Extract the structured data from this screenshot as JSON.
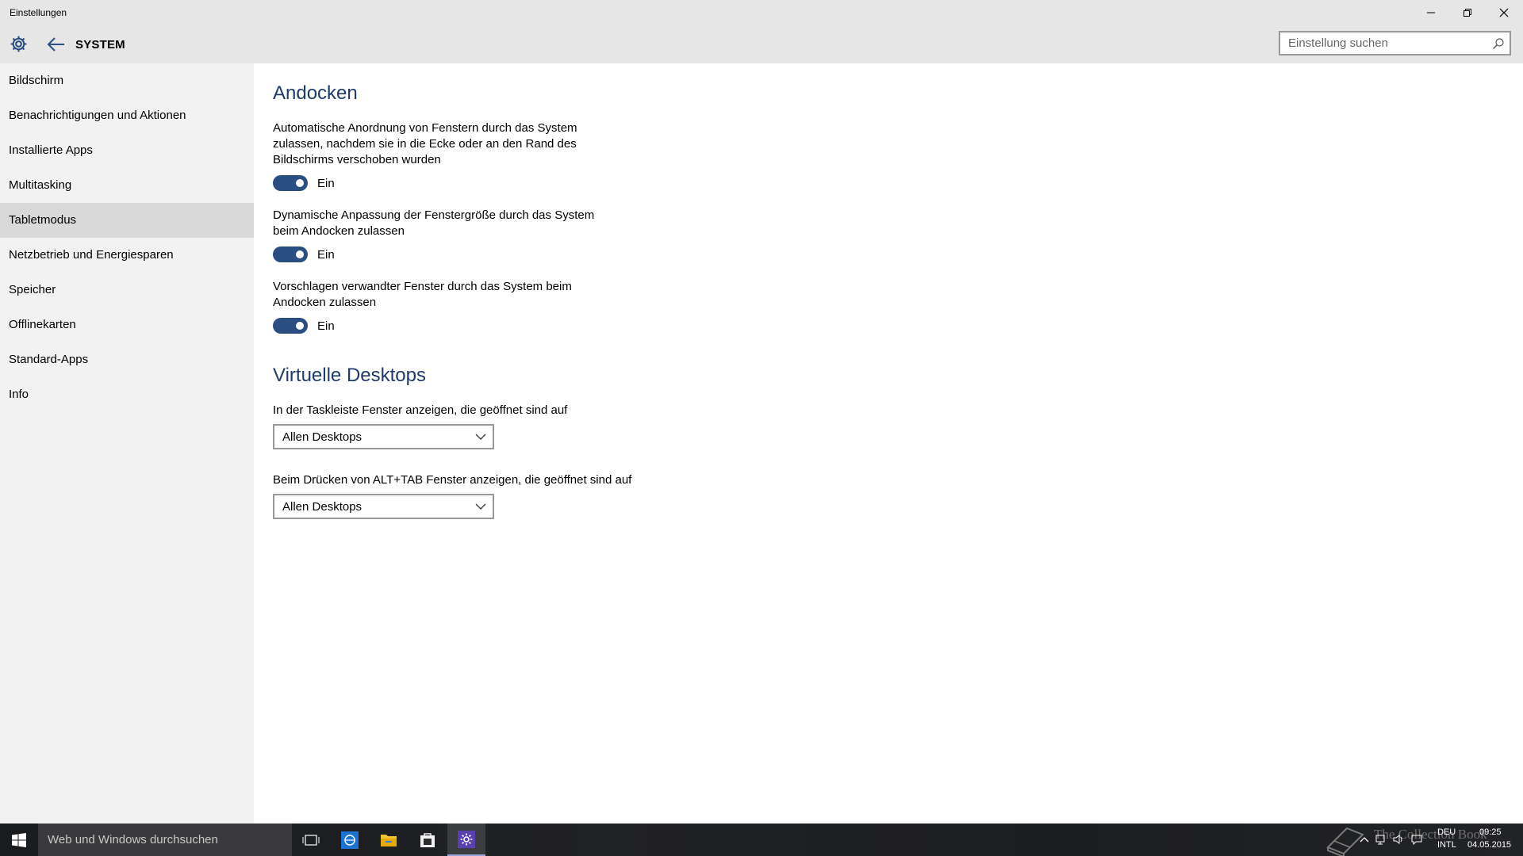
{
  "window": {
    "title": "Einstellungen"
  },
  "header": {
    "section_title": "SYSTEM",
    "search_placeholder": "Einstellung suchen"
  },
  "sidebar": {
    "items": [
      {
        "label": "Bildschirm"
      },
      {
        "label": "Benachrichtigungen und Aktionen"
      },
      {
        "label": "Installierte Apps"
      },
      {
        "label": "Multitasking"
      },
      {
        "label": "Tabletmodus"
      },
      {
        "label": "Netzbetrieb und Energiesparen"
      },
      {
        "label": "Speicher"
      },
      {
        "label": "Offlinekarten"
      },
      {
        "label": "Standard-Apps"
      },
      {
        "label": "Info"
      }
    ],
    "selected": "Tabletmodus"
  },
  "main": {
    "snap": {
      "heading": "Andocken",
      "settings": [
        {
          "description": "Automatische Anordnung von Fenstern durch das System zulassen, nachdem sie in die Ecke oder an den Rand des Bildschirms verschoben wurden",
          "state": "Ein",
          "on": true
        },
        {
          "description": "Dynamische Anpassung der Fenstergröße durch das System beim Andocken zulassen",
          "state": "Ein",
          "on": true
        },
        {
          "description": "Vorschlagen verwandter Fenster durch das System beim Andocken zulassen",
          "state": "Ein",
          "on": true
        }
      ]
    },
    "virtual_desktops": {
      "heading": "Virtuelle Desktops",
      "taskbar_label": "In der Taskleiste Fenster anzeigen, die geöffnet sind auf",
      "taskbar_value": "Allen Desktops",
      "alttab_label": "Beim Drücken von ALT+TAB Fenster anzeigen, die geöffnet sind auf",
      "alttab_value": "Allen Desktops"
    }
  },
  "taskbar": {
    "search_placeholder": "Web und Windows durchsuchen",
    "watermark": "The Collection Book",
    "lang_top": "DEU",
    "lang_bottom": "INTL",
    "time": "09:25",
    "date": "04.05.2015"
  },
  "colors": {
    "accent": "#2b4e82",
    "heading": "#1f3a6b",
    "sidebar_bg": "#f2f2f2",
    "selected_bg": "#d9d9d9",
    "header_bg": "#e6e6e6",
    "taskbar_bg": "#1e1f21"
  },
  "icons": [
    "gear-icon",
    "back-arrow-icon",
    "search-icon",
    "minimize-icon",
    "restore-icon",
    "close-icon",
    "windows-start-icon",
    "task-view-icon",
    "ie-icon",
    "file-explorer-icon",
    "store-icon",
    "settings-app-icon",
    "chevron-down-icon",
    "chevron-up-icon",
    "network-icon",
    "volume-icon",
    "action-center-icon"
  ]
}
